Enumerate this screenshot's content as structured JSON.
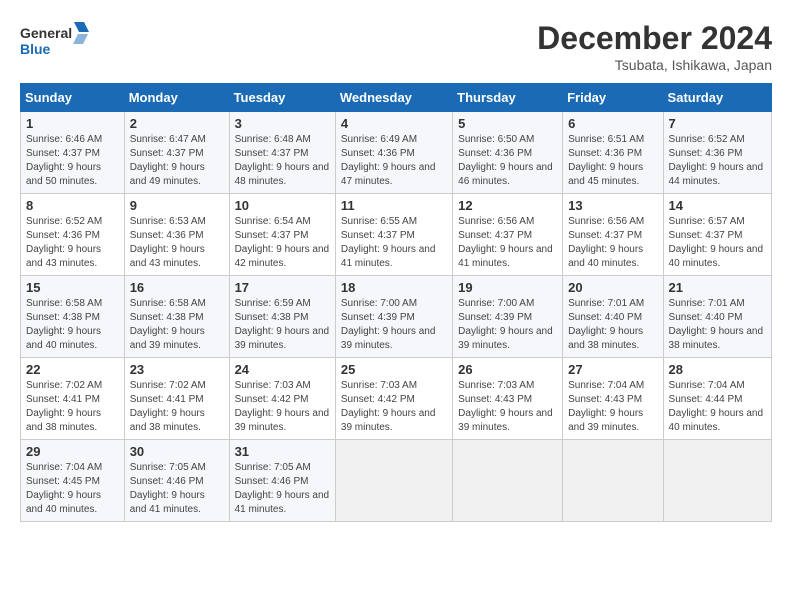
{
  "logo": {
    "line1": "General",
    "line2": "Blue"
  },
  "title": "December 2024",
  "subtitle": "Tsubata, Ishikawa, Japan",
  "weekdays": [
    "Sunday",
    "Monday",
    "Tuesday",
    "Wednesday",
    "Thursday",
    "Friday",
    "Saturday"
  ],
  "weeks": [
    [
      {
        "day": "1",
        "sunrise": "6:46 AM",
        "sunset": "4:37 PM",
        "daylight": "9 hours and 50 minutes."
      },
      {
        "day": "2",
        "sunrise": "6:47 AM",
        "sunset": "4:37 PM",
        "daylight": "9 hours and 49 minutes."
      },
      {
        "day": "3",
        "sunrise": "6:48 AM",
        "sunset": "4:37 PM",
        "daylight": "9 hours and 48 minutes."
      },
      {
        "day": "4",
        "sunrise": "6:49 AM",
        "sunset": "4:36 PM",
        "daylight": "9 hours and 47 minutes."
      },
      {
        "day": "5",
        "sunrise": "6:50 AM",
        "sunset": "4:36 PM",
        "daylight": "9 hours and 46 minutes."
      },
      {
        "day": "6",
        "sunrise": "6:51 AM",
        "sunset": "4:36 PM",
        "daylight": "9 hours and 45 minutes."
      },
      {
        "day": "7",
        "sunrise": "6:52 AM",
        "sunset": "4:36 PM",
        "daylight": "9 hours and 44 minutes."
      }
    ],
    [
      {
        "day": "8",
        "sunrise": "6:52 AM",
        "sunset": "4:36 PM",
        "daylight": "9 hours and 43 minutes."
      },
      {
        "day": "9",
        "sunrise": "6:53 AM",
        "sunset": "4:36 PM",
        "daylight": "9 hours and 43 minutes."
      },
      {
        "day": "10",
        "sunrise": "6:54 AM",
        "sunset": "4:37 PM",
        "daylight": "9 hours and 42 minutes."
      },
      {
        "day": "11",
        "sunrise": "6:55 AM",
        "sunset": "4:37 PM",
        "daylight": "9 hours and 41 minutes."
      },
      {
        "day": "12",
        "sunrise": "6:56 AM",
        "sunset": "4:37 PM",
        "daylight": "9 hours and 41 minutes."
      },
      {
        "day": "13",
        "sunrise": "6:56 AM",
        "sunset": "4:37 PM",
        "daylight": "9 hours and 40 minutes."
      },
      {
        "day": "14",
        "sunrise": "6:57 AM",
        "sunset": "4:37 PM",
        "daylight": "9 hours and 40 minutes."
      }
    ],
    [
      {
        "day": "15",
        "sunrise": "6:58 AM",
        "sunset": "4:38 PM",
        "daylight": "9 hours and 40 minutes."
      },
      {
        "day": "16",
        "sunrise": "6:58 AM",
        "sunset": "4:38 PM",
        "daylight": "9 hours and 39 minutes."
      },
      {
        "day": "17",
        "sunrise": "6:59 AM",
        "sunset": "4:38 PM",
        "daylight": "9 hours and 39 minutes."
      },
      {
        "day": "18",
        "sunrise": "7:00 AM",
        "sunset": "4:39 PM",
        "daylight": "9 hours and 39 minutes."
      },
      {
        "day": "19",
        "sunrise": "7:00 AM",
        "sunset": "4:39 PM",
        "daylight": "9 hours and 39 minutes."
      },
      {
        "day": "20",
        "sunrise": "7:01 AM",
        "sunset": "4:40 PM",
        "daylight": "9 hours and 38 minutes."
      },
      {
        "day": "21",
        "sunrise": "7:01 AM",
        "sunset": "4:40 PM",
        "daylight": "9 hours and 38 minutes."
      }
    ],
    [
      {
        "day": "22",
        "sunrise": "7:02 AM",
        "sunset": "4:41 PM",
        "daylight": "9 hours and 38 minutes."
      },
      {
        "day": "23",
        "sunrise": "7:02 AM",
        "sunset": "4:41 PM",
        "daylight": "9 hours and 38 minutes."
      },
      {
        "day": "24",
        "sunrise": "7:03 AM",
        "sunset": "4:42 PM",
        "daylight": "9 hours and 39 minutes."
      },
      {
        "day": "25",
        "sunrise": "7:03 AM",
        "sunset": "4:42 PM",
        "daylight": "9 hours and 39 minutes."
      },
      {
        "day": "26",
        "sunrise": "7:03 AM",
        "sunset": "4:43 PM",
        "daylight": "9 hours and 39 minutes."
      },
      {
        "day": "27",
        "sunrise": "7:04 AM",
        "sunset": "4:43 PM",
        "daylight": "9 hours and 39 minutes."
      },
      {
        "day": "28",
        "sunrise": "7:04 AM",
        "sunset": "4:44 PM",
        "daylight": "9 hours and 40 minutes."
      }
    ],
    [
      {
        "day": "29",
        "sunrise": "7:04 AM",
        "sunset": "4:45 PM",
        "daylight": "9 hours and 40 minutes."
      },
      {
        "day": "30",
        "sunrise": "7:05 AM",
        "sunset": "4:46 PM",
        "daylight": "9 hours and 41 minutes."
      },
      {
        "day": "31",
        "sunrise": "7:05 AM",
        "sunset": "4:46 PM",
        "daylight": "9 hours and 41 minutes."
      },
      null,
      null,
      null,
      null
    ]
  ],
  "labels": {
    "sunrise": "Sunrise:",
    "sunset": "Sunset:",
    "daylight": "Daylight:"
  }
}
